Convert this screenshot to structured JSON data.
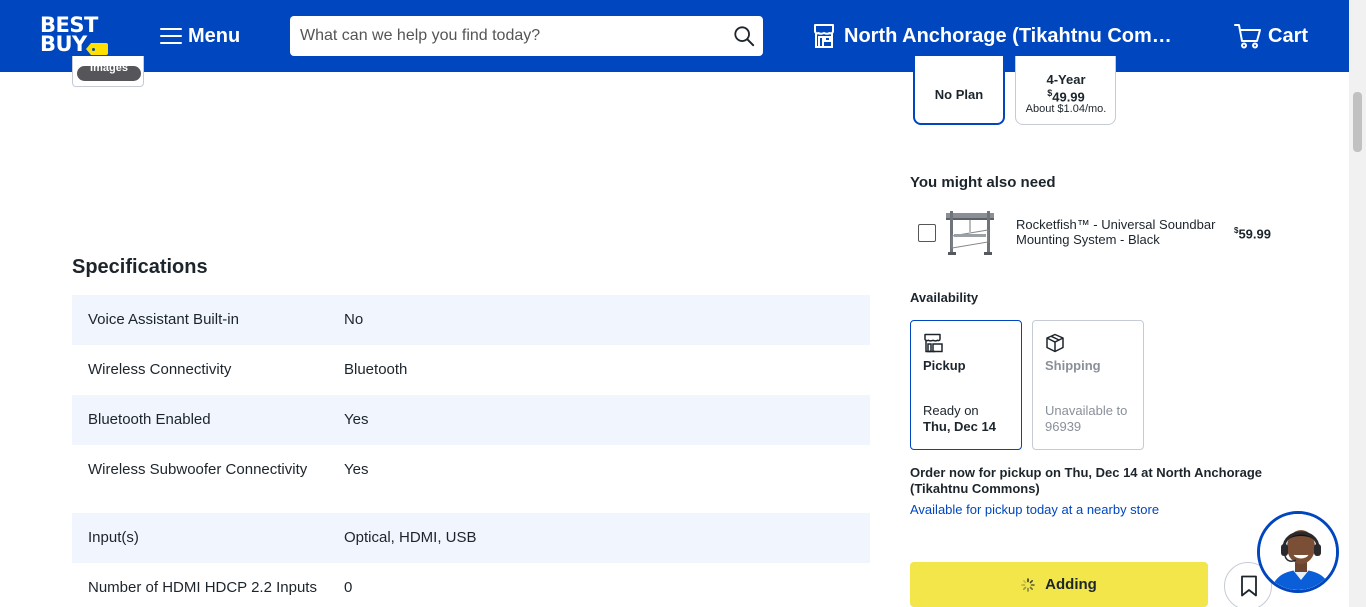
{
  "header": {
    "logo_line1": "BEST",
    "logo_line2": "BUY",
    "menu_label": "Menu",
    "search_placeholder": "What can we help you find today?",
    "store_label": "North Anchorage (Tikahtnu Commons)",
    "cart_label": "Cart",
    "bg_color": "#0046be",
    "accent_color": "#ffe000"
  },
  "media": {
    "images_pill": "Images"
  },
  "specifications": {
    "title": "Specifications",
    "rows": [
      {
        "key": "Voice Assistant Built-in",
        "value": "No"
      },
      {
        "key": "Wireless Connectivity",
        "value": "Bluetooth"
      },
      {
        "key": "Bluetooth Enabled",
        "value": "Yes"
      },
      {
        "key": "Wireless Subwoofer Connectivity",
        "value": "Yes"
      },
      {
        "key": "Input(s)",
        "value": "Optical, HDMI, USB"
      },
      {
        "key": "Number of HDMI HDCP 2.2 Inputs",
        "value": "0"
      }
    ]
  },
  "protection_plans": {
    "no_plan_label": "No Plan",
    "four_year_label": "4-Year",
    "four_year_price_symbol": "$",
    "four_year_price": "49.99",
    "four_year_monthly": "About $1.04/mo."
  },
  "you_might_also_need": {
    "title": "You might also need",
    "item_name": "Rocketfish™ - Universal Soundbar Mounting System - Black",
    "item_price_symbol": "$",
    "item_price": "59.99"
  },
  "availability": {
    "title": "Availability",
    "pickup": {
      "label": "Pickup",
      "line1": "Ready on",
      "line2": "Thu, Dec 14"
    },
    "shipping": {
      "label": "Shipping",
      "line1": "Unavailable to",
      "line2": "96939"
    },
    "order_note": "Order now for pickup on Thu, Dec 14 at North Anchorage (Tikahtnu Commons)",
    "nearby_link": "Available for pickup today at a nearby store"
  },
  "actions": {
    "add_label": "Adding",
    "add_color": "#f2e64b"
  }
}
